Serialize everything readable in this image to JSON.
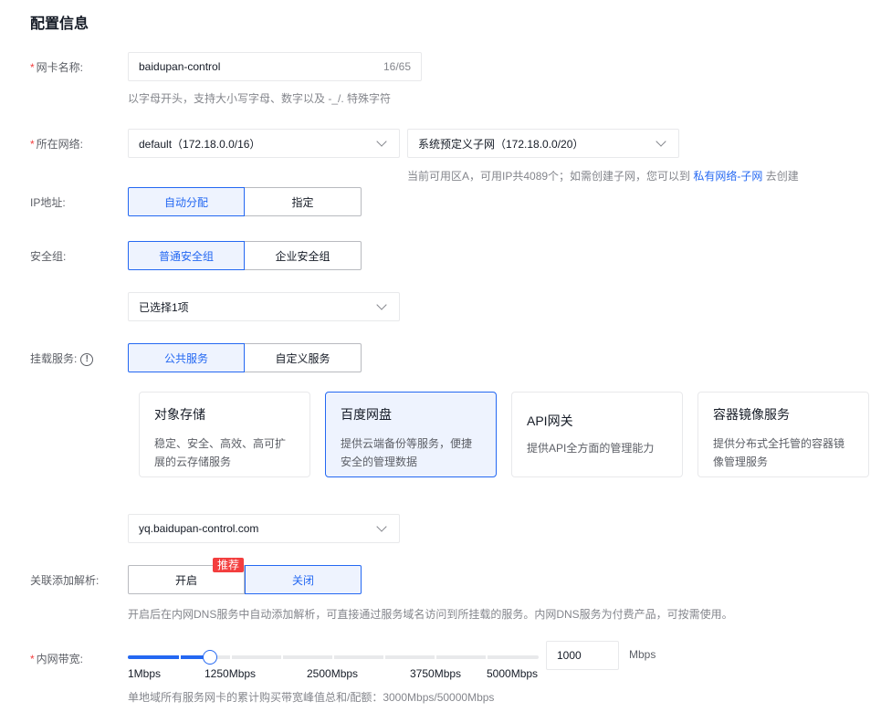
{
  "section_title": "配置信息",
  "required_mark": "*",
  "nic_name": {
    "label": "网卡名称:",
    "value": "baidupan-control",
    "count": "16/65",
    "hint": "以字母开头，支持大小写字母、数字以及 -_/. 特殊字符"
  },
  "network": {
    "label": "所在网络:",
    "vpc_value": "default（172.18.0.0/16）",
    "subnet_value": "系统预定义子网（172.18.0.0/20）",
    "hint_prefix": "当前可用区A，可用IP共4089个；如需创建子网，您可以到",
    "hint_link": "私有网络-子网",
    "hint_suffix": "去创建"
  },
  "ip": {
    "label": "IP地址:",
    "options": [
      "自动分配",
      "指定"
    ],
    "selected": 0
  },
  "security_group": {
    "label": "安全组:",
    "options": [
      "普通安全组",
      "企业安全组"
    ],
    "selected": 0,
    "select_value": "已选择1项"
  },
  "mount_service": {
    "label": "挂载服务:",
    "info_icon": "info-circle-icon",
    "options": [
      "公共服务",
      "自定义服务"
    ],
    "selected": 0,
    "cards": [
      {
        "title": "对象存储",
        "desc": "稳定、安全、高效、高可扩展的云存储服务"
      },
      {
        "title": "百度网盘",
        "desc": "提供云端备份等服务，便捷安全的管理数据"
      },
      {
        "title": "API网关",
        "desc": "提供API全方面的管理能力"
      },
      {
        "title": "容器镜像服务",
        "desc": "提供分布式全托管的容器镜像管理服务"
      }
    ],
    "selected_card": 1,
    "domain_value": "yq.baidupan-control.com"
  },
  "dns": {
    "label": "关联添加解析:",
    "options": [
      "开启",
      "关闭"
    ],
    "badge": "推荐",
    "selected": 1,
    "hint": "开启后在内网DNS服务中自动添加解析，可直接通过服务域名访问到所挂载的服务。内网DNS服务为付费产品，可按需使用。"
  },
  "bandwidth": {
    "label": "内网带宽:",
    "value": "1000",
    "unit": "Mbps",
    "min": 1,
    "max": 5000,
    "current": 1000,
    "tick_labels": [
      "1Mbps",
      "1250Mbps",
      "2500Mbps",
      "3750Mbps",
      "5000Mbps"
    ],
    "hint": "单地域所有服务网卡的累计购买带宽峰值总和/配额：3000Mbps/50000Mbps"
  },
  "colors": {
    "primary": "#2468f2",
    "required": "#f33e3e",
    "badge": "#f33e3e"
  }
}
